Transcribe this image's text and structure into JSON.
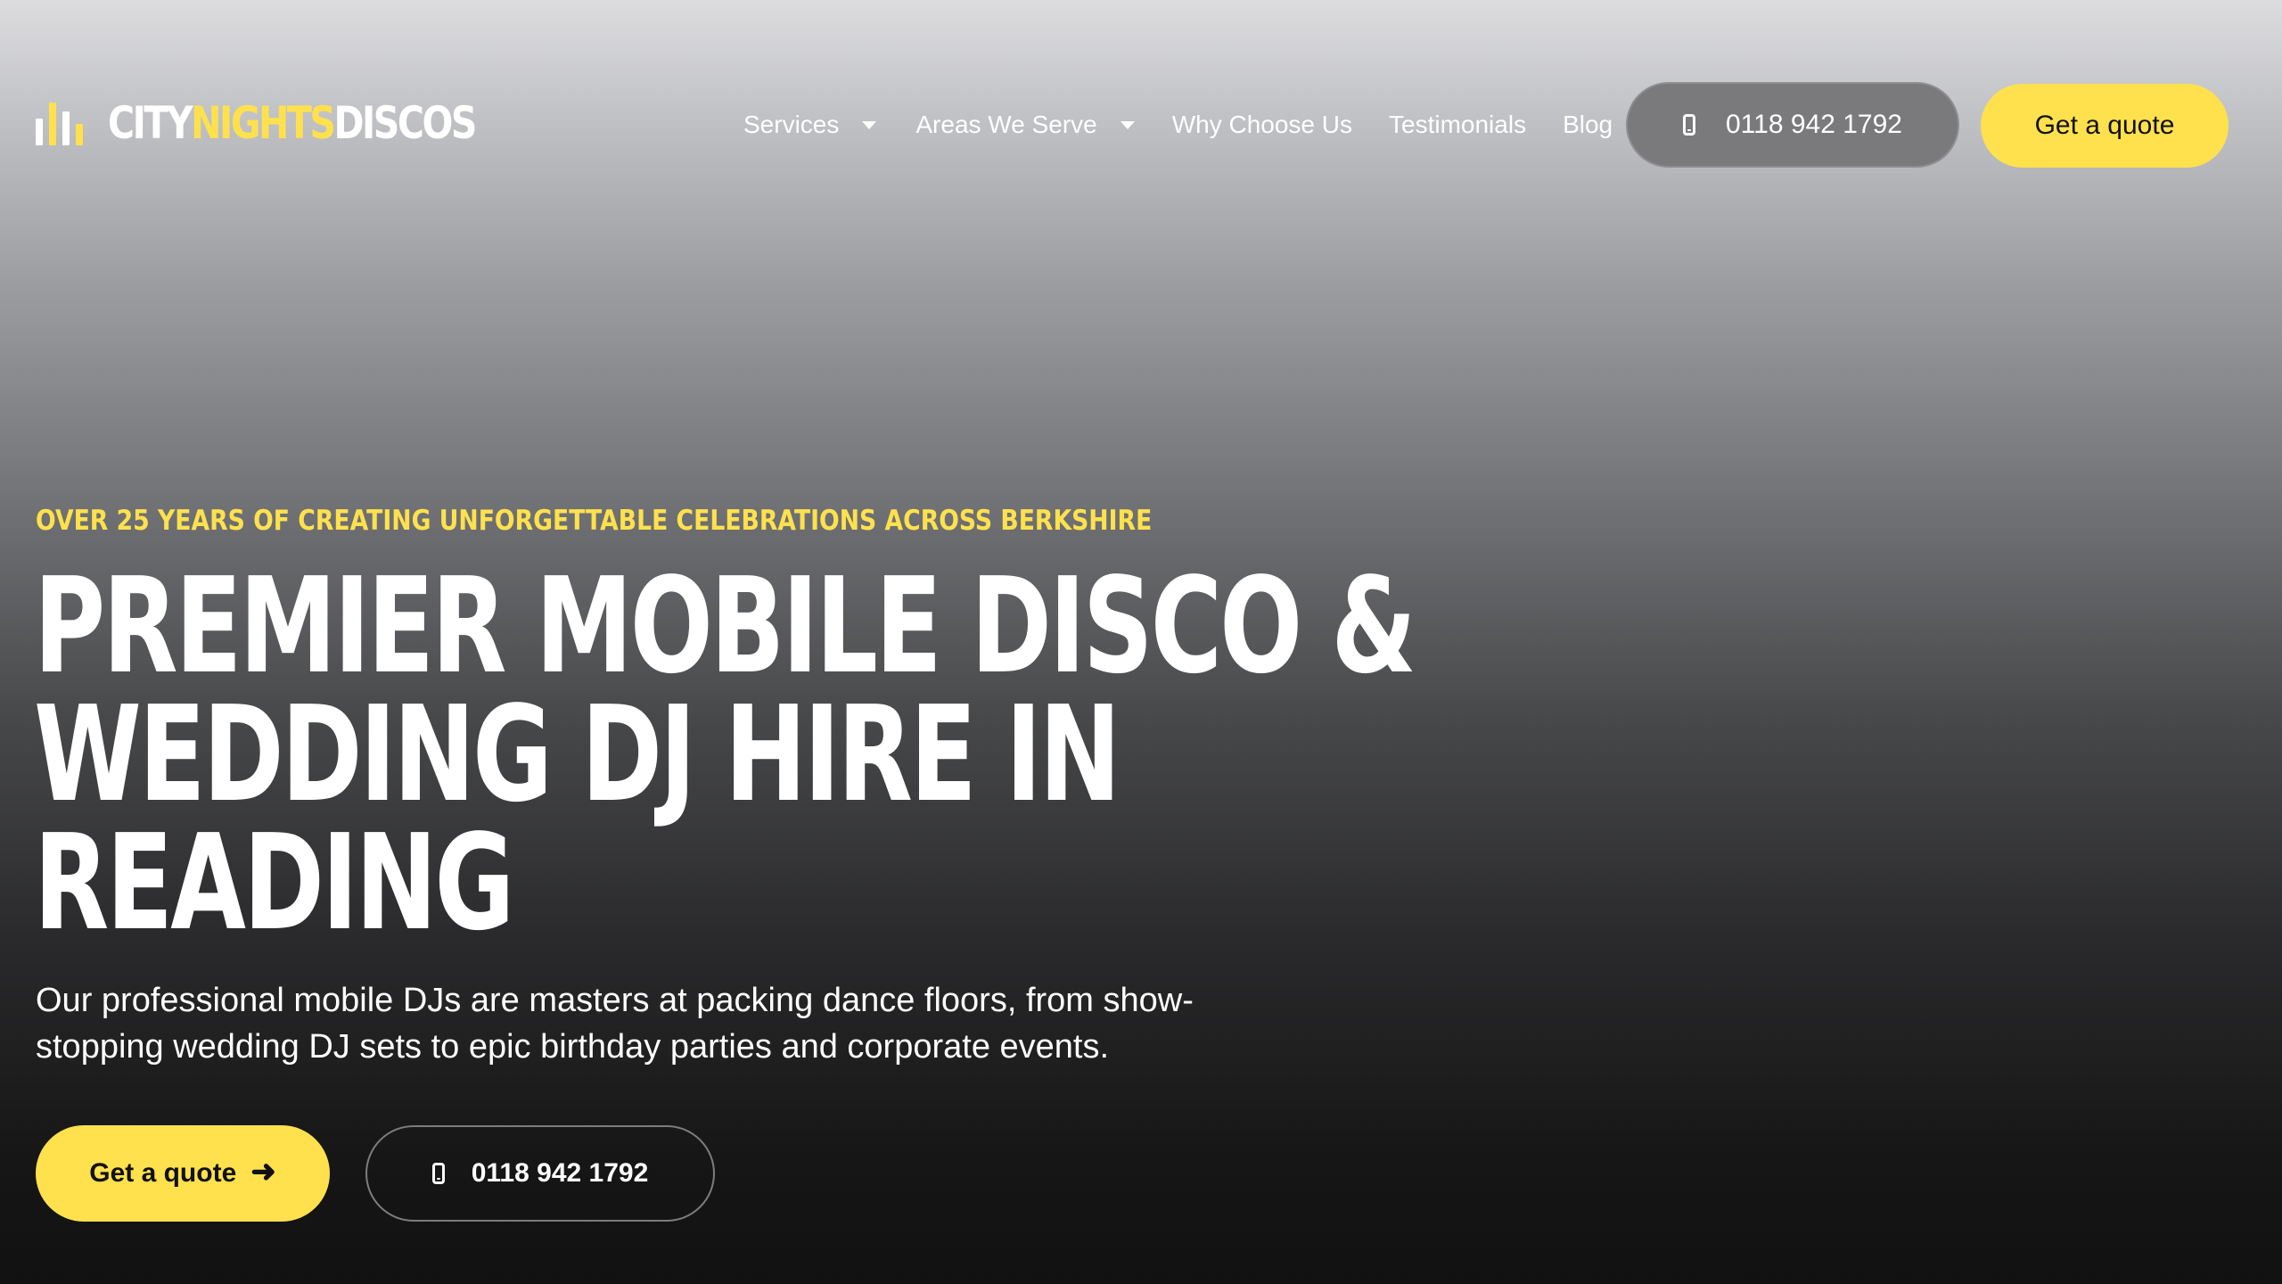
{
  "header": {
    "logo": {
      "part1": "CITY",
      "part2": "NIGHTS",
      "part3": "DISCOS"
    },
    "nav": {
      "services": "Services",
      "areas": "Areas We Serve",
      "why": "Why Choose Us",
      "testimonials": "Testimonials",
      "blog": "Blog"
    },
    "phone": "0118 942 1792",
    "quote_label": "Get a quote"
  },
  "hero": {
    "eyebrow": "OVER 25 YEARS OF CREATING UNFORGETTABLE CELEBRATIONS ACROSS BERKSHIRE",
    "headline_lines": [
      "PREMIER MOBILE DISCO &",
      "WEDDING DJ HIRE IN",
      "READING"
    ],
    "subtitle_lines": [
      "Our professional mobile DJs are masters at packing dance floors, from show-",
      "stopping wedding DJ sets to epic birthday parties and corporate events."
    ],
    "primary_cta": "Get a quote",
    "secondary_cta_phone": "0118 942 1792"
  },
  "colors": {
    "accent": "#ffe14d",
    "text": "#ffffff",
    "dark": "#111111"
  },
  "icons": {
    "logo_mark": "equalizer-bars-icon",
    "dropdown": "caret-down-icon",
    "phone": "mobile-phone-icon",
    "arrow": "arrow-right-icon"
  }
}
